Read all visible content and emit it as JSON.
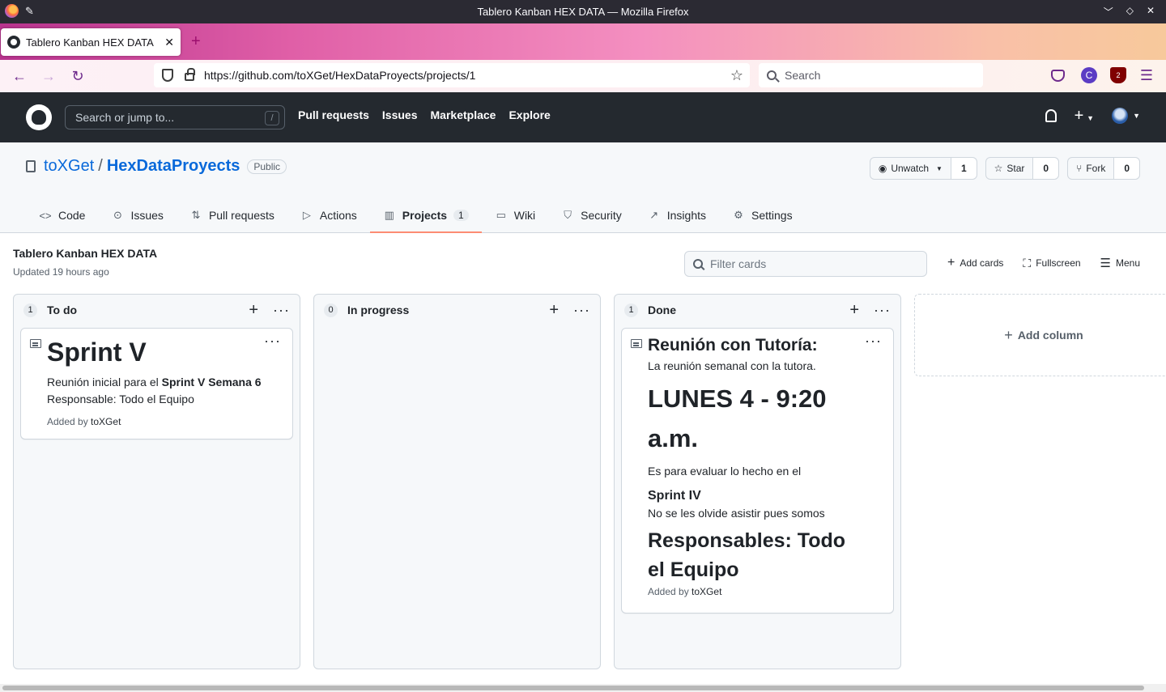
{
  "browser": {
    "window_title": "Tablero Kanban HEX DATA — Mozilla Firefox",
    "tab_title": "Tablero Kanban HEX DATA",
    "url": "https://github.com/toXGet/HexDataProyects/projects/1",
    "search_placeholder": "Search",
    "ublock_badge": "2",
    "ext_c_label": "C"
  },
  "github": {
    "search_placeholder": "Search or jump to...",
    "search_shortcut": "/",
    "nav": [
      "Pull requests",
      "Issues",
      "Marketplace",
      "Explore"
    ]
  },
  "repo": {
    "owner": "toXGet",
    "name": "HexDataProyects",
    "visibility": "Public",
    "unwatch_label": "Unwatch",
    "watch_count": "1",
    "star_label": "Star",
    "star_count": "0",
    "fork_label": "Fork",
    "fork_count": "0",
    "tabs": [
      {
        "label": "Code"
      },
      {
        "label": "Issues"
      },
      {
        "label": "Pull requests"
      },
      {
        "label": "Actions"
      },
      {
        "label": "Projects",
        "counter": "1"
      },
      {
        "label": "Wiki"
      },
      {
        "label": "Security"
      },
      {
        "label": "Insights"
      },
      {
        "label": "Settings"
      }
    ]
  },
  "project": {
    "title": "Tablero Kanban HEX DATA",
    "updated": "Updated 19 hours ago",
    "filter_placeholder": "Filter cards",
    "add_cards": "Add cards",
    "fullscreen": "Fullscreen",
    "menu": "Menu",
    "add_column": "Add column",
    "columns": [
      {
        "name": "To do",
        "count": "1"
      },
      {
        "name": "In progress",
        "count": "0"
      },
      {
        "name": "Done",
        "count": "1"
      }
    ],
    "card_todo": {
      "heading": "Sprint V",
      "line1_prefix": "Reunión inicial para el ",
      "line1_bold": "Sprint V Semana 6",
      "line2": "Responsable: Todo el Equipo",
      "added_prefix": "Added by ",
      "added_user": "toXGet"
    },
    "card_done": {
      "heading": "Reunión con Tutoría:",
      "line1": "La reunión semanal con la tutora.",
      "big": "LUNES 4 - 9:20 a.m.",
      "line2": "Es para evaluar lo hecho en el",
      "subheading": "Sprint IV",
      "line3": "No se les olvide asistir pues somos",
      "heading2": "Responsables: Todo el Equipo",
      "added_prefix": "Added by ",
      "added_user": "toXGet"
    }
  }
}
